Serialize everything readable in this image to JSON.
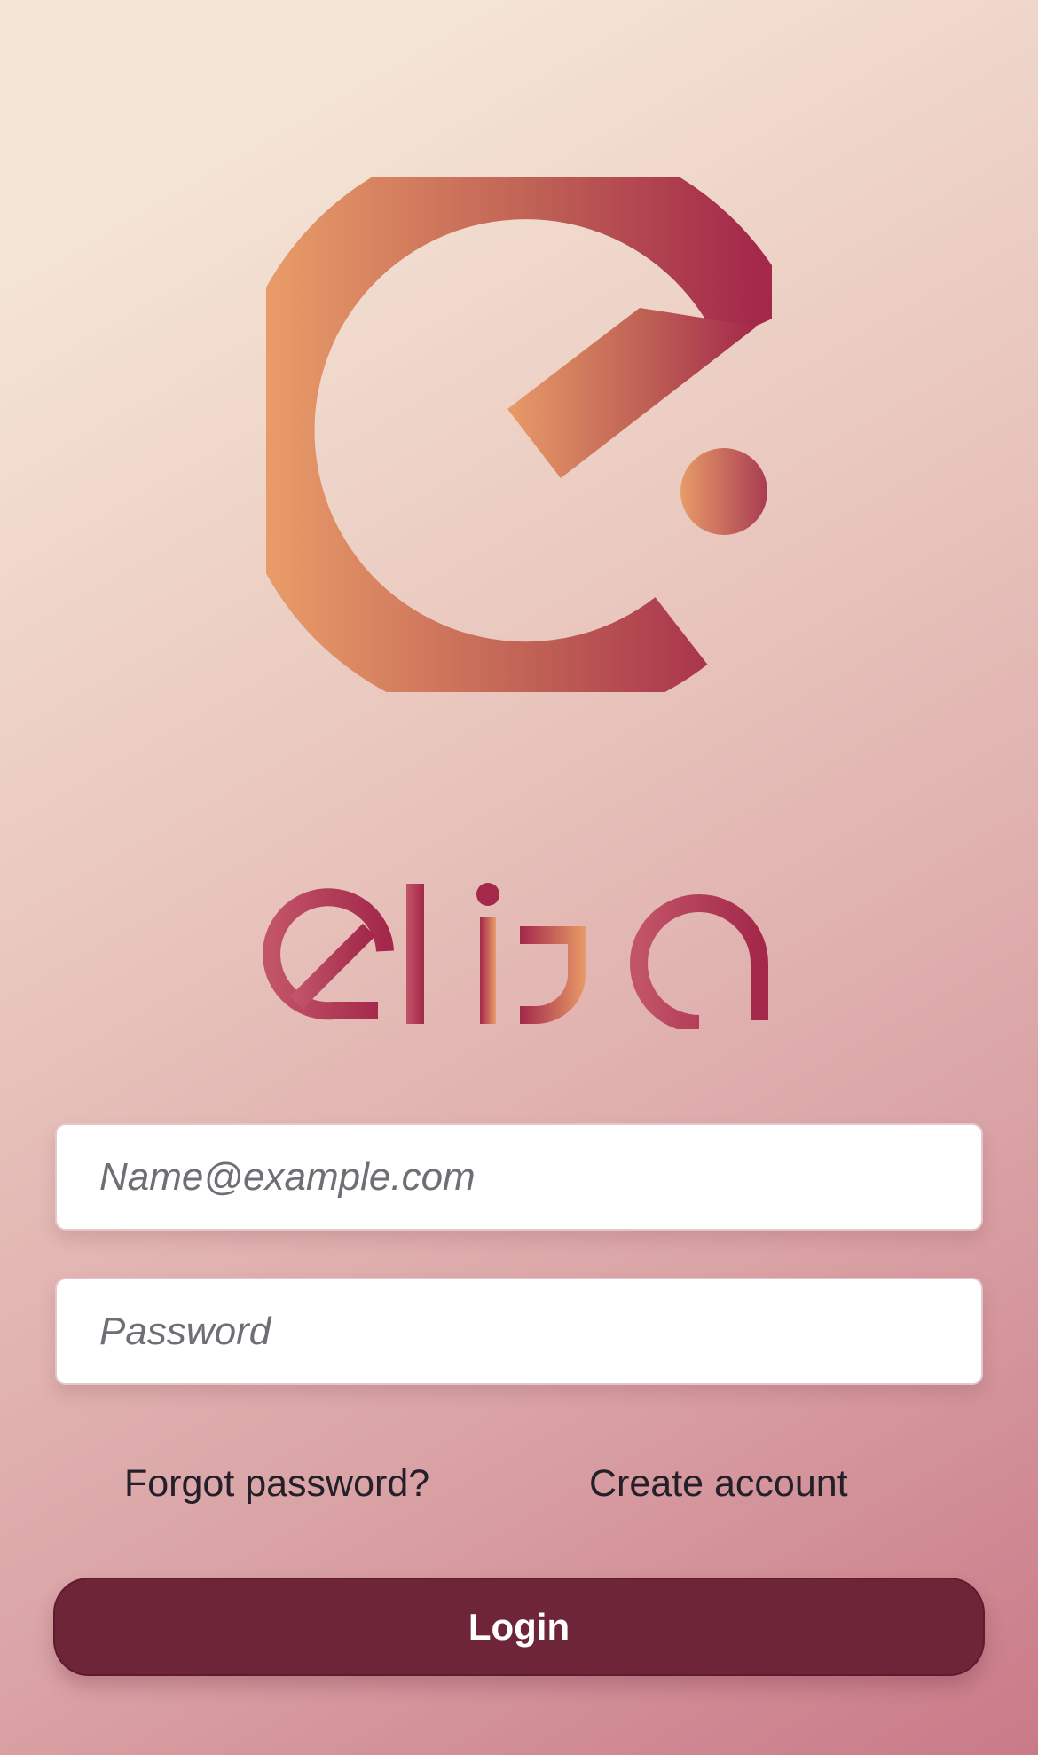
{
  "brand": {
    "name": "elija",
    "gradient_start": "#e89b68",
    "gradient_end": "#a3284a"
  },
  "form": {
    "email_placeholder": "Name@example.com",
    "email_value": "",
    "password_placeholder": "Password",
    "password_value": ""
  },
  "links": {
    "forgot_password": "Forgot password?",
    "create_account": "Create account"
  },
  "actions": {
    "login_label": "Login"
  },
  "colors": {
    "background_top_left": "#f5e5d6",
    "background_bottom_right": "#c97a88",
    "login_button": "#6e2538",
    "link_text": "#24202a",
    "placeholder_text": "#6f6e74"
  }
}
